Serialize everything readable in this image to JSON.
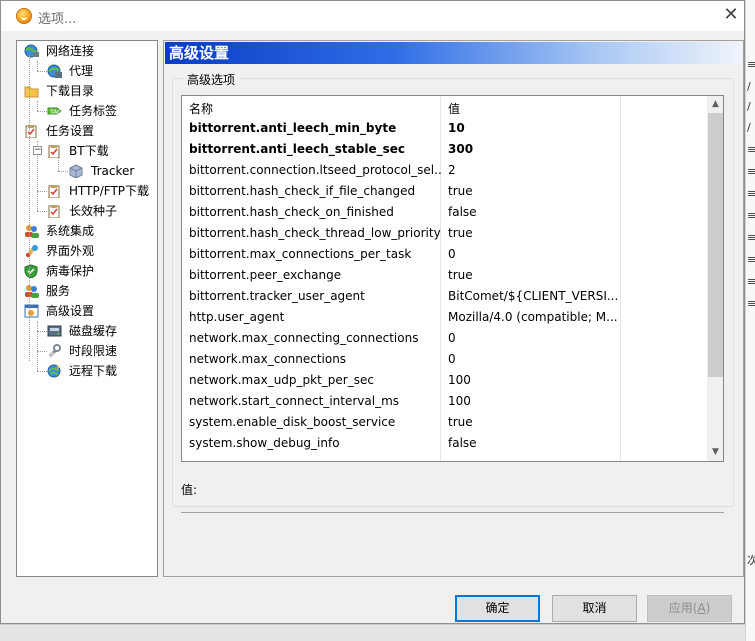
{
  "window": {
    "title": "选项..."
  },
  "background_app": {
    "glyphs": [
      "≡",
      "/",
      "/",
      "/",
      "≡",
      "≡",
      "≡",
      "≡",
      "≡",
      "≡",
      "≡",
      "≡",
      "次"
    ]
  },
  "sidebar": {
    "items": [
      {
        "label": "网络连接",
        "icon": "globe-network-icon"
      },
      {
        "label": "代理",
        "icon": "globe-proxy-icon"
      },
      {
        "label": "下载目录",
        "icon": "folder-icon"
      },
      {
        "label": "任务标签",
        "icon": "tag-icon"
      },
      {
        "label": "任务设置",
        "icon": "clipboard-icon"
      },
      {
        "label": "BT下载",
        "icon": "clipboard-icon"
      },
      {
        "label": "Tracker",
        "icon": "cube-icon"
      },
      {
        "label": "HTTP/FTP下载",
        "icon": "clipboard-icon"
      },
      {
        "label": "长效种子",
        "icon": "clipboard-icon"
      },
      {
        "label": "系统集成",
        "icon": "users-icon"
      },
      {
        "label": "界面外观",
        "icon": "paint-icon"
      },
      {
        "label": "病毒保护",
        "icon": "shield-icon"
      },
      {
        "label": "服务",
        "icon": "users-icon"
      },
      {
        "label": "高级设置",
        "icon": "advanced-settings-icon"
      },
      {
        "label": "磁盘缓存",
        "icon": "disk-icon"
      },
      {
        "label": "时段限速",
        "icon": "wrench-icon"
      },
      {
        "label": "远程下载",
        "icon": "globe-remote-icon"
      }
    ]
  },
  "panel": {
    "title": "高级设置",
    "group_title": "高级选项",
    "columns": {
      "name": "名称",
      "value": "值"
    },
    "rows": [
      {
        "name": "bittorrent.anti_leech_min_byte",
        "value": "10",
        "bold": true
      },
      {
        "name": "bittorrent.anti_leech_stable_sec",
        "value": "300",
        "bold": true
      },
      {
        "name": "bittorrent.connection.ltseed_protocol_sel...",
        "value": "2",
        "bold": false
      },
      {
        "name": "bittorrent.hash_check_if_file_changed",
        "value": "true",
        "bold": false
      },
      {
        "name": "bittorrent.hash_check_on_finished",
        "value": "false",
        "bold": false
      },
      {
        "name": "bittorrent.hash_check_thread_low_priority",
        "value": "true",
        "bold": false
      },
      {
        "name": "bittorrent.max_connections_per_task",
        "value": "0",
        "bold": false
      },
      {
        "name": "bittorrent.peer_exchange",
        "value": "true",
        "bold": false
      },
      {
        "name": "bittorrent.tracker_user_agent",
        "value": "BitComet/${CLIENT_VERSI...",
        "bold": false
      },
      {
        "name": "http.user_agent",
        "value": "Mozilla/4.0 (compatible; M...",
        "bold": false
      },
      {
        "name": "network.max_connecting_connections",
        "value": "0",
        "bold": false
      },
      {
        "name": "network.max_connections",
        "value": "0",
        "bold": false
      },
      {
        "name": "network.max_udp_pkt_per_sec",
        "value": "100",
        "bold": false
      },
      {
        "name": "network.start_connect_interval_ms",
        "value": "100",
        "bold": false
      },
      {
        "name": "system.enable_disk_boost_service",
        "value": "true",
        "bold": false
      },
      {
        "name": "system.show_debug_info",
        "value": "false",
        "bold": false
      }
    ],
    "value_label": "值:"
  },
  "buttons": {
    "ok": "确定",
    "cancel": "取消",
    "apply_text": "应用(",
    "apply_key": "A",
    "apply_close": ")"
  }
}
